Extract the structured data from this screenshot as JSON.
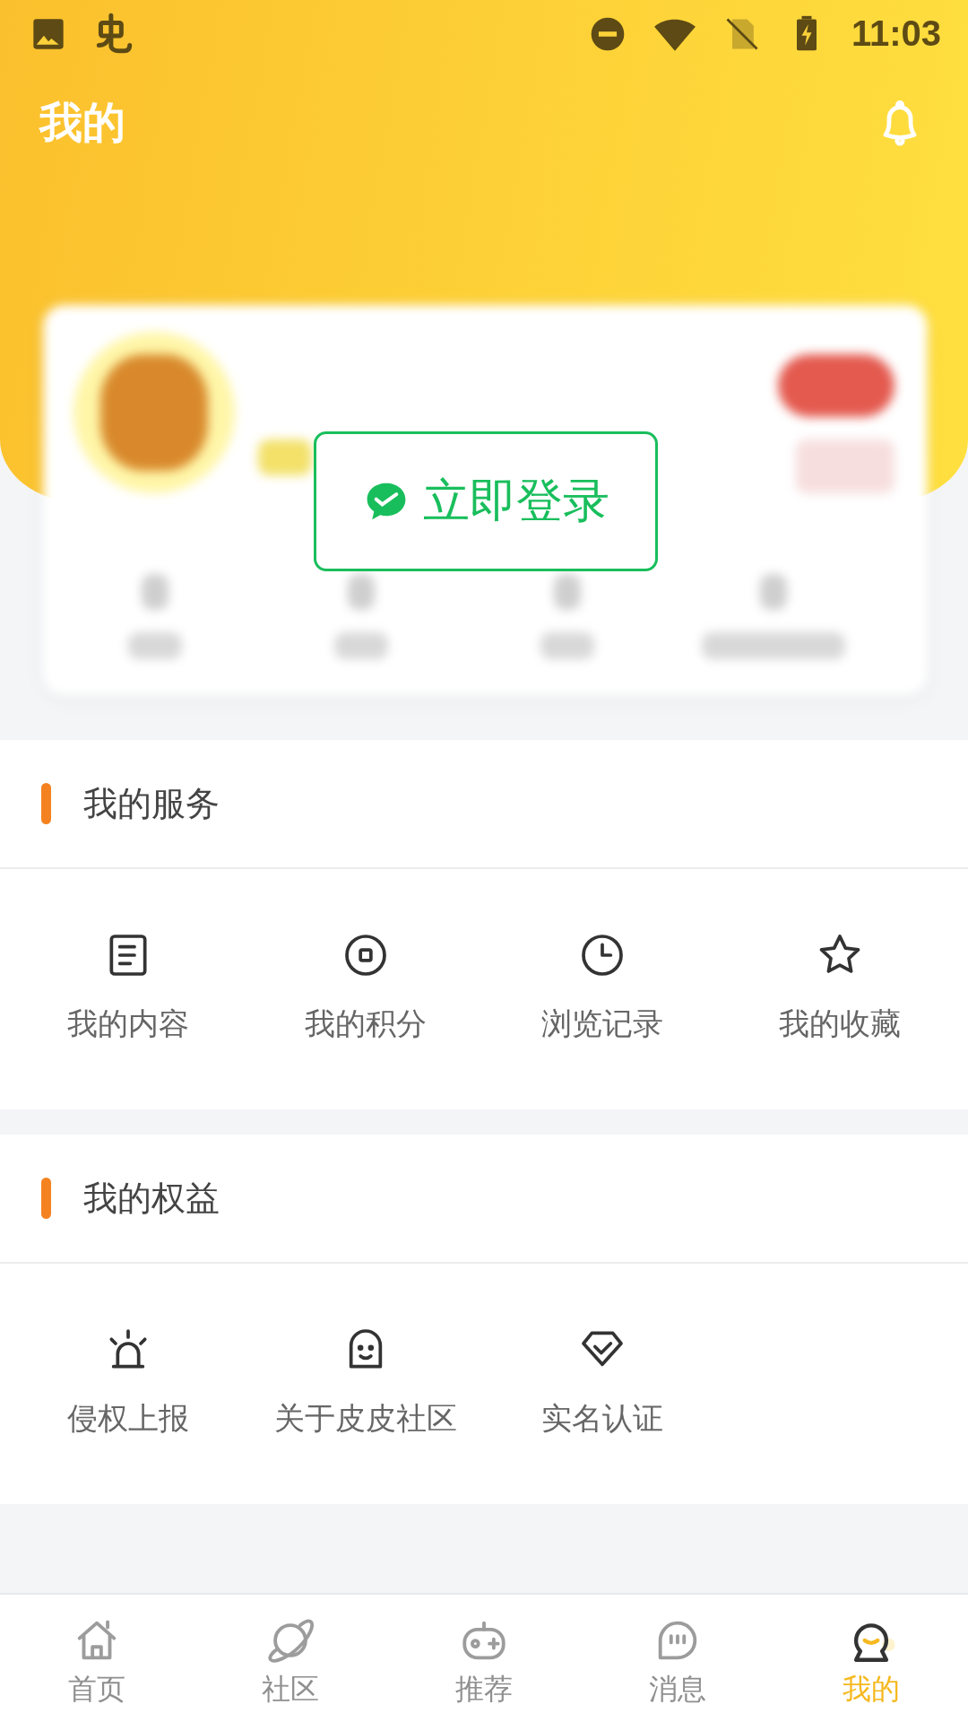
{
  "status_bar": {
    "time": "11:03"
  },
  "header": {
    "title": "我的"
  },
  "login_button": {
    "label": "立即登录"
  },
  "sections": [
    {
      "title": "我的服务",
      "items": [
        {
          "label": "我的内容",
          "kind": "doc"
        },
        {
          "label": "我的积分",
          "kind": "coin"
        },
        {
          "label": "浏览记录",
          "kind": "clock"
        },
        {
          "label": "我的收藏",
          "kind": "star"
        }
      ]
    },
    {
      "title": "我的权益",
      "items": [
        {
          "label": "侵权上报",
          "kind": "alarm"
        },
        {
          "label": "关于皮皮社区",
          "kind": "smile"
        },
        {
          "label": "实名认证",
          "kind": "shield"
        }
      ]
    }
  ],
  "bottom_nav": [
    {
      "label": "首页",
      "kind": "home",
      "selected": false
    },
    {
      "label": "社区",
      "kind": "planet",
      "selected": false
    },
    {
      "label": "推荐",
      "kind": "gamepad",
      "selected": false
    },
    {
      "label": "消息",
      "kind": "chat",
      "selected": false
    },
    {
      "label": "我的",
      "kind": "me",
      "selected": true
    }
  ]
}
